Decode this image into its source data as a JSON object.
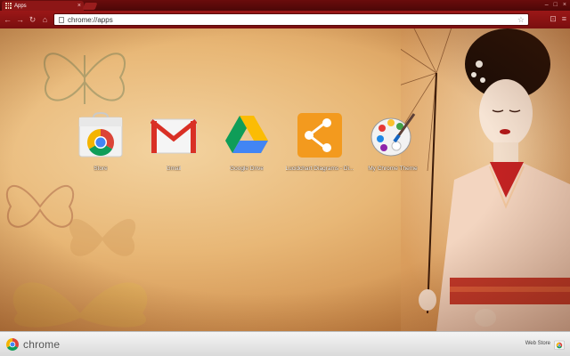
{
  "window": {
    "tab_title": "Apps",
    "tab_close": "×",
    "controls": {
      "minimize": "–",
      "maximize": "□",
      "close": "×"
    }
  },
  "toolbar": {
    "back": "←",
    "forward": "→",
    "reload": "↻",
    "home": "⌂",
    "url": "chrome://apps",
    "star": "☆",
    "menu": "≡",
    "extension": "⊡"
  },
  "apps": [
    {
      "label": "Store",
      "icon": "chrome-web-store-icon"
    },
    {
      "label": "Gmail",
      "icon": "gmail-icon"
    },
    {
      "label": "Google Drive",
      "icon": "google-drive-icon"
    },
    {
      "label": "Lucidchart Diagrams - Di...",
      "icon": "lucidchart-icon"
    },
    {
      "label": "My Chrome Theme",
      "icon": "palette-icon"
    }
  ],
  "footer": {
    "brand": "chrome",
    "webstore_label": "Web Store"
  },
  "colors": {
    "tab_strip": "#5c0909",
    "toolbar": "#8d1414",
    "background_paper": "#e8b776"
  }
}
